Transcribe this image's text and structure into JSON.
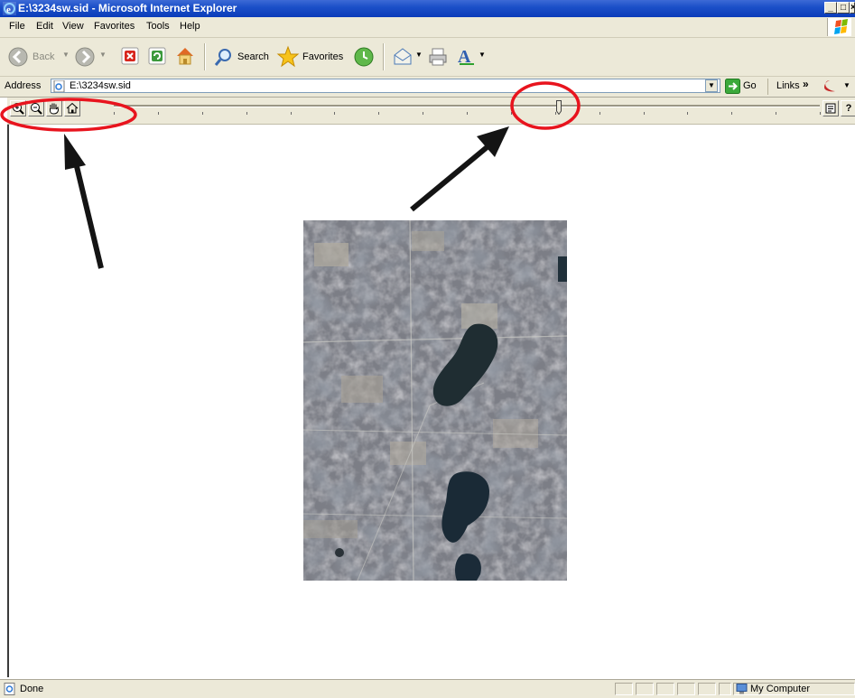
{
  "window": {
    "title": "E:\\3234sw.sid - Microsoft Internet Explorer",
    "minimize": "_",
    "maximize": "□",
    "close": "×"
  },
  "menu": [
    "File",
    "Edit",
    "View",
    "Favorites",
    "Tools",
    "Help"
  ],
  "toolbar": {
    "back_label": "Back",
    "search_label": "Search",
    "favorites_label": "Favorites"
  },
  "address": {
    "label": "Address",
    "value": "E:\\3234sw.sid",
    "go_label": "Go",
    "links_label": "Links",
    "links_chevron": "»"
  },
  "plugin_toolbar": {
    "help_label": "?",
    "zoom_slider_value": 0.63
  },
  "status": {
    "text": "Done",
    "zone": "My Computer"
  },
  "colors": {
    "titlebar": "#0a3cba",
    "chrome": "#ece9d8",
    "annotation": "#e8141e"
  }
}
